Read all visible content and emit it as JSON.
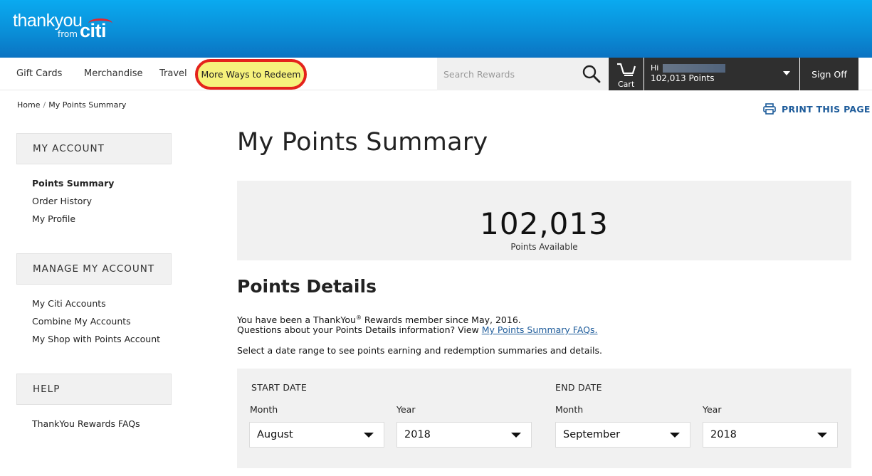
{
  "brand": {
    "logo_text": "thankyou",
    "logo_from": "from",
    "logo_citi": "citi",
    "accent_color": "#0a8fd8",
    "highlight_color": "#f6f27c",
    "circle_color": "#e4231c"
  },
  "nav": {
    "items": [
      "Gift Cards",
      "Merchandise",
      "Travel"
    ],
    "highlighted": "More Ways to Redeem"
  },
  "search": {
    "placeholder": "Search Rewards",
    "icon": "search-icon"
  },
  "cart": {
    "label": "Cart",
    "icon": "cart-icon"
  },
  "account": {
    "greeting": "Hi",
    "points": "102,013 Points"
  },
  "signoff": "Sign Off",
  "breadcrumb": {
    "home": "Home",
    "separator": "/",
    "current": "My Points Summary"
  },
  "print_label": "PRINT THIS PAGE",
  "sidebar": {
    "sections": [
      {
        "title": "MY ACCOUNT",
        "links": [
          "Points Summary",
          "Order History",
          "My Profile"
        ],
        "active": "Points Summary"
      },
      {
        "title": "MANAGE MY ACCOUNT",
        "links": [
          "My Citi Accounts",
          "Combine My Accounts",
          "My Shop with Points Account"
        ]
      },
      {
        "title": "HELP",
        "links": [
          "ThankYou Rewards FAQs"
        ]
      }
    ]
  },
  "main": {
    "title": "My Points Summary",
    "points_value": "102,013",
    "points_label": "Points Available",
    "details_title": "Points Details",
    "member_text_a": "You have been a ThankYou",
    "member_reg": "®",
    "member_text_b": " Rewards member since May, 2016.",
    "faq_text": "Questions about your Points Details information? View ",
    "faq_link": "My Points Summary FAQs.",
    "select_text": "Select a date range to see points earning and redemption summaries and details."
  },
  "date_range": {
    "start": {
      "heading": "START DATE",
      "month_label": "Month",
      "year_label": "Year",
      "month": "August",
      "year": "2018"
    },
    "end": {
      "heading": "END DATE",
      "month_label": "Month",
      "year_label": "Year",
      "month": "September",
      "year": "2018"
    }
  }
}
